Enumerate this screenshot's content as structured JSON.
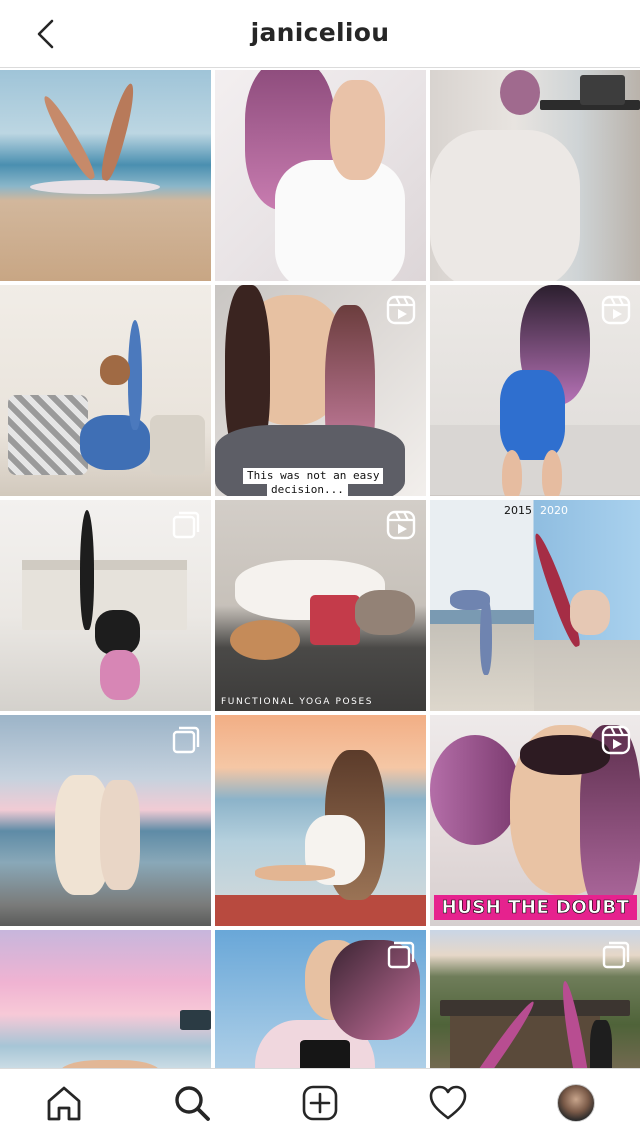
{
  "header": {
    "title": "janiceliou",
    "back_icon": "chevron-left-icon"
  },
  "posts": [
    {
      "id": "post-1",
      "type": "image",
      "scene": "beach acro yoga"
    },
    {
      "id": "post-2",
      "type": "image",
      "scene": "pink hair portrait"
    },
    {
      "id": "post-3",
      "type": "image",
      "scene": "balcony blanket laptop"
    },
    {
      "id": "post-4",
      "type": "image",
      "scene": "living room standing split"
    },
    {
      "id": "post-5",
      "type": "reel",
      "caption": "This was not an easy decision..."
    },
    {
      "id": "post-6",
      "type": "reel",
      "scene": "blue swimsuit bathroom"
    },
    {
      "id": "post-7",
      "type": "carousel",
      "scene": "memorial inversion"
    },
    {
      "id": "post-8",
      "type": "reel",
      "caption": "FUNCTIONAL YOGA POSES"
    },
    {
      "id": "post-9",
      "type": "image",
      "year_left": "2015",
      "year_right": "2020"
    },
    {
      "id": "post-10",
      "type": "carousel",
      "scene": "beach friends sunset"
    },
    {
      "id": "post-11",
      "type": "image",
      "scene": "boat sunset"
    },
    {
      "id": "post-12",
      "type": "reel",
      "caption": "HUSH THE DOUBT"
    },
    {
      "id": "post-13",
      "type": "image",
      "scene": "pink sunset beach pose"
    },
    {
      "id": "post-14",
      "type": "carousel",
      "scene": "wind hair puffer jacket"
    },
    {
      "id": "post-15",
      "type": "carousel",
      "scene": "mountain chalet balance"
    }
  ],
  "tabbar": {
    "items": [
      "home-icon",
      "search-icon",
      "add-post-icon",
      "heart-icon",
      "profile-avatar"
    ]
  },
  "colors": {
    "border": "#dbdbdb",
    "text": "#262626",
    "accent_pink": "#e6228e"
  }
}
